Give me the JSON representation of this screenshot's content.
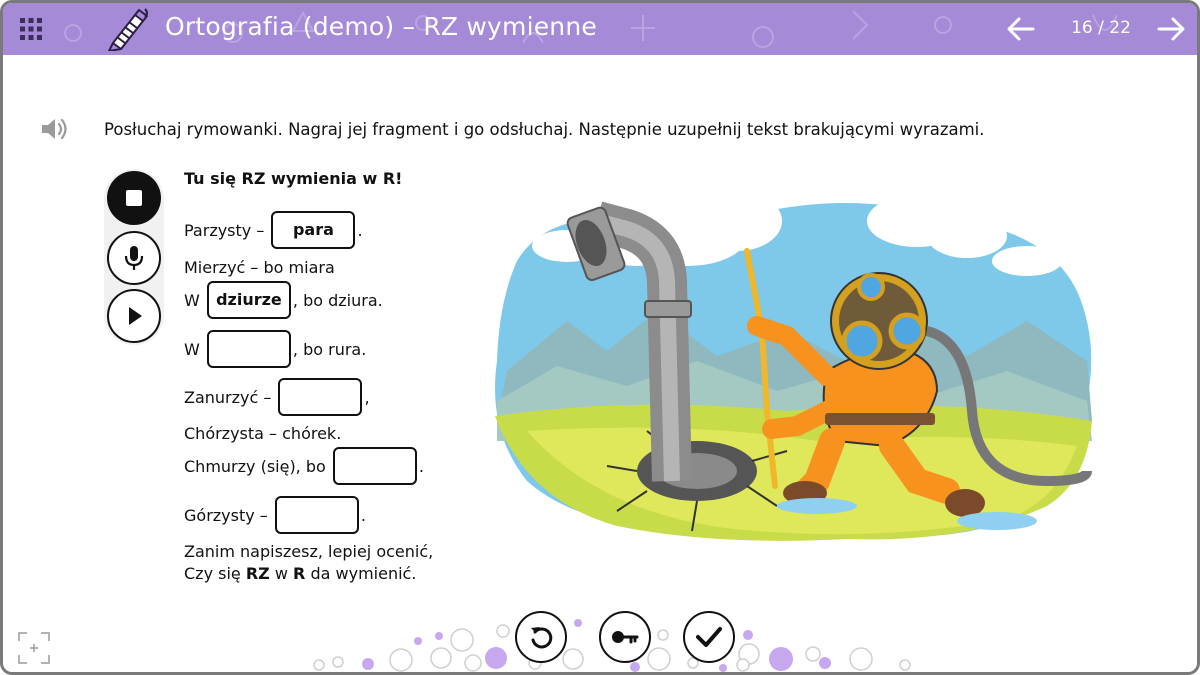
{
  "header": {
    "title": "Ortografia (demo) – RZ wymienne",
    "page_counter": "16 / 22",
    "menu_icon": "grid-menu-icon",
    "logo_icon": "pencil-logo-icon",
    "prev_icon": "arrow-left-icon",
    "next_icon": "arrow-right-icon",
    "background_color": "#a58ad8"
  },
  "instruction": {
    "icon": "speaker-icon",
    "text": "Posłuchaj rymowanki. Nagraj jej fragment i go odsłuchaj. Następnie uzupełnij tekst brakującymi wyrazami."
  },
  "recorder": {
    "stop_icon": "stop-icon",
    "mic_icon": "microphone-icon",
    "play_icon": "play-icon"
  },
  "rhyme": {
    "title": "Tu się RZ wymienia w R!",
    "lines": [
      {
        "before": "Parzysty –",
        "blank": "para",
        "after": "."
      },
      {
        "text": "Mierzyć – bo miara"
      },
      {
        "before": "W",
        "blank": "dziurze",
        "after": ", bo dziura."
      },
      {
        "before": "W",
        "blank": "",
        "after": ", bo rura."
      },
      {
        "before": "Zanurzyć –",
        "blank": "",
        "after": ","
      },
      {
        "text": "Chórzysta – chórek."
      },
      {
        "before": "Chmurzy (się), bo",
        "blank": "",
        "after": "."
      },
      {
        "before": "Górzysty –",
        "blank": "",
        "after": "."
      }
    ],
    "ending_line1": "Zanim napiszesz, lepiej ocenić,",
    "ending_line2_a": "Czy się ",
    "ending_line2_b": "RZ",
    "ending_line2_c": " w ",
    "ending_line2_d": "R",
    "ending_line2_e": " da wymienić."
  },
  "illustration": {
    "subject": "diver-with-pipe-illustration"
  },
  "actions": {
    "reset_icon": "reset-icon",
    "key_icon": "key-icon",
    "check_icon": "check-icon",
    "expand_icon": "expand-icon"
  },
  "colors": {
    "accent": "#a58ad8",
    "bubble_fill": "#c5a8ee"
  }
}
